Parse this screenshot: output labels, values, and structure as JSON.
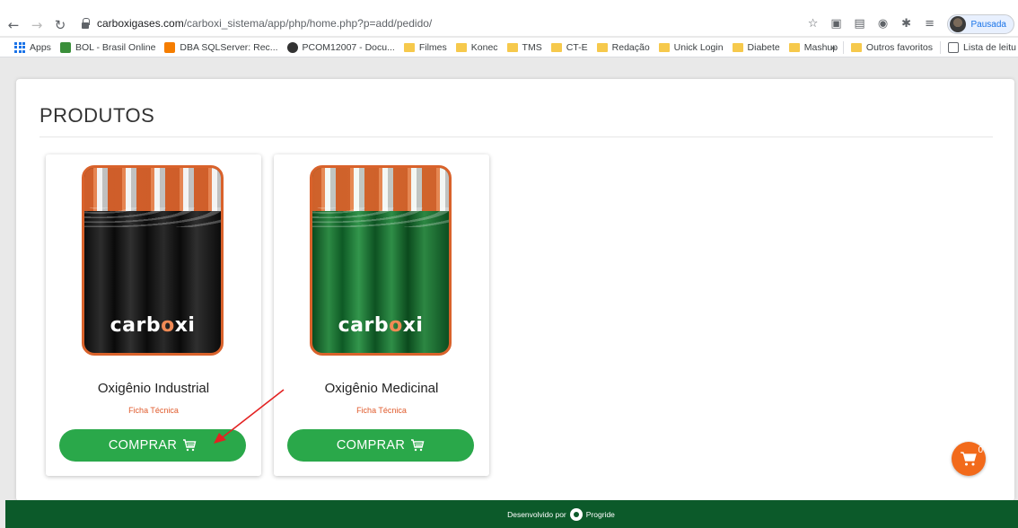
{
  "browser": {
    "url_host": "carboxigases.com",
    "url_path": "/carboxi_sistema/app/php/home.php?p=add/pedido/",
    "profile_label": "Pausada",
    "bookmarks": [
      {
        "label": "Apps",
        "icon": "apps-grid-icon"
      },
      {
        "label": "BOL - Brasil Online",
        "icon": "bol-icon"
      },
      {
        "label": "DBA SQLServer: Rec...",
        "icon": "blogger-icon"
      },
      {
        "label": "PCOM12007 - Docu...",
        "icon": "circle-icon"
      },
      {
        "label": "Filmes",
        "icon": "folder-icon"
      },
      {
        "label": "Konec",
        "icon": "folder-icon"
      },
      {
        "label": "TMS",
        "icon": "folder-icon"
      },
      {
        "label": "CT-E",
        "icon": "folder-icon"
      },
      {
        "label": "Redação",
        "icon": "folder-icon"
      },
      {
        "label": "Unick Login",
        "icon": "folder-icon"
      },
      {
        "label": "Diabete",
        "icon": "folder-icon"
      },
      {
        "label": "Mashup",
        "icon": "folder-icon"
      }
    ],
    "bookmarks_overflow": "»",
    "other_favorites": "Outros favoritos",
    "reading_list": "Lista de leitu"
  },
  "page": {
    "title": "PRODUTOS",
    "products": [
      {
        "name": "Oxigênio Industrial",
        "tech_sheet": "Ficha Técnica",
        "buy_label": "COMPRAR",
        "brand_a": "carb",
        "brand_o": "o",
        "brand_b": "xi"
      },
      {
        "name": "Oxigênio Medicinal",
        "tech_sheet": "Ficha Técnica",
        "buy_label": "COMPRAR",
        "brand_a": "carb",
        "brand_o": "o",
        "brand_b": "xi"
      }
    ],
    "cart_count": "0"
  },
  "footer": {
    "developed_by": "Desenvolvido por",
    "company": "Progride"
  },
  "colors": {
    "buy_button": "#2aa84a",
    "footer": "#0c5a2a",
    "cart_fab": "#f26a1b",
    "accent_orange": "#e05a2b"
  }
}
